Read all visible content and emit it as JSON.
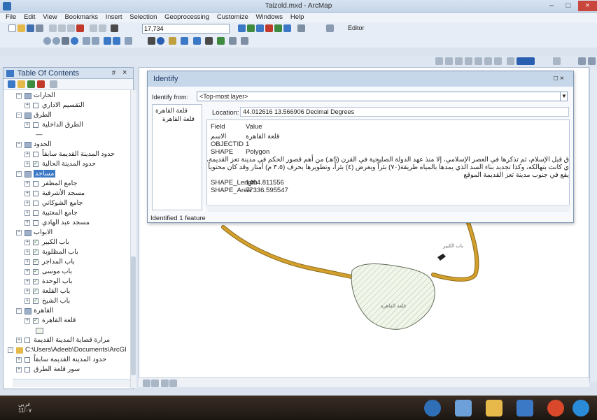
{
  "window": {
    "title": "Taizold.mxd - ArcMap"
  },
  "menu": [
    "File",
    "Edit",
    "View",
    "Bookmarks",
    "Insert",
    "Selection",
    "Geoprocessing",
    "Customize",
    "Windows",
    "Help"
  ],
  "toolbar": {
    "scale": "17,734",
    "editor_label": "Editor"
  },
  "toc": {
    "title": "Table Of Contents",
    "pin": "#",
    "close": "×",
    "rows": [
      {
        "label": "الحارات",
        "indent": 1,
        "type": "group",
        "expanded": true
      },
      {
        "label": "التقسيم الاداري",
        "indent": 2,
        "type": "layer",
        "checked": false
      },
      {
        "label": "الطرق",
        "indent": 1,
        "type": "group",
        "expanded": true
      },
      {
        "label": "الطرق الداخلية",
        "indent": 2,
        "type": "layer",
        "checked": false
      },
      {
        "label": "—",
        "indent": 3,
        "type": "legend"
      },
      {
        "label": "الحدود",
        "indent": 1,
        "type": "group",
        "expanded": true
      },
      {
        "label": "حدود المدينة القديمة سابقاً",
        "indent": 2,
        "type": "layer",
        "checked": false
      },
      {
        "label": "حدود المدينة الحالية",
        "indent": 2,
        "type": "layer",
        "checked": true
      },
      {
        "label": "مساجد",
        "indent": 1,
        "type": "group",
        "expanded": true,
        "selected": true
      },
      {
        "label": "جامع المظفر",
        "indent": 2,
        "type": "layer",
        "checked": false
      },
      {
        "label": "مسجد الأشرفية",
        "indent": 2,
        "type": "layer",
        "checked": false
      },
      {
        "label": "جامع الشوكاني",
        "indent": 2,
        "type": "layer",
        "checked": false
      },
      {
        "label": "جامع المعتبية",
        "indent": 2,
        "type": "layer",
        "checked": false
      },
      {
        "label": "مسجد عبد الهادي",
        "indent": 2,
        "type": "layer",
        "checked": false
      },
      {
        "label": "الابواب",
        "indent": 1,
        "type": "group",
        "expanded": true
      },
      {
        "label": "باب الكبير",
        "indent": 2,
        "type": "layer",
        "checked": true
      },
      {
        "label": "باب المظلوبة",
        "indent": 2,
        "type": "layer",
        "checked": true
      },
      {
        "label": "باب المداجر",
        "indent": 2,
        "type": "layer",
        "checked": true
      },
      {
        "label": "باب موسى",
        "indent": 2,
        "type": "layer",
        "checked": true
      },
      {
        "label": "باب الوحدة",
        "indent": 2,
        "type": "layer",
        "checked": true
      },
      {
        "label": "باب القلعة",
        "indent": 2,
        "type": "layer",
        "checked": true
      },
      {
        "label": "باب الشيخ",
        "indent": 2,
        "type": "layer",
        "checked": true
      },
      {
        "label": "القاهرة",
        "indent": 1,
        "type": "group",
        "expanded": true
      },
      {
        "label": "قلعة القاهرة",
        "indent": 2,
        "type": "layer",
        "checked": true
      },
      {
        "label": "",
        "indent": 3,
        "type": "swatch"
      },
      {
        "label": "مرارة قصاية المدينة القديمة",
        "indent": 1,
        "type": "layer",
        "checked": false
      },
      {
        "label": "C:\\Users\\Adeeb\\Documents\\ArcGI",
        "indent": 0,
        "type": "folder",
        "expanded": true
      },
      {
        "label": "حدود المدينة القديمة سابقاً",
        "indent": 1,
        "type": "layer",
        "checked": false
      },
      {
        "label": "سور قلعة الطرق",
        "indent": 1,
        "type": "layer",
        "checked": false
      }
    ]
  },
  "identify": {
    "title": "Identify",
    "win_buttons": "□ ×",
    "from_label": "Identify from:",
    "from_value": "<Top-most layer>",
    "tree_parent": "قلعة القاهرة",
    "tree_child": "قلعة القاهرة",
    "location_label": "Location:",
    "location_value": "44.012616  13.566906 Decimal Degrees",
    "grid_header": {
      "field": "Field",
      "value": "Value"
    },
    "rows": [
      {
        "field": "الاسم",
        "value": "قلعة القاهرة"
      },
      {
        "field": "OBJECTID",
        "value": "1"
      },
      {
        "field": "SHAPE",
        "value": "Polygon"
      },
      {
        "field": "",
        "value": "ق قبل الإسلام، ثم تذكرها في العصر الإسلامي، إلا منذ عهد الدولة الصليحية في القرن (5هـ) من أهم قصور الحكم في مدينة تعز القديمة، وهي أهم قوى الضيافة  الوصف التاريخي"
      },
      {
        "field": "",
        "value": "ي كانت بتهالكه، وكذا تجديد بناء السد الذي يمدها بالمياه طريقة(٧٠) بئراً وبعرض (٤) بئراً، وتطويرها بحرف (٣،٥ م) أمتار وقد كان محتوياً تحت الإغلاق، كما أصيب   أعمال الترميم"
      },
      {
        "field": "",
        "value": "يقع في جنوب مدينة تعز القديمة    الموقع"
      },
      {
        "field": "SHAPE_Length",
        "value": "1404.811556"
      },
      {
        "field": "SHAPE_Area",
        "value": "77336.595547"
      }
    ],
    "footer": "Identified 1 feature"
  },
  "map": {
    "label_small": "باب الكبير",
    "label_polygon": "قلعة القاهرة",
    "road_color": "#d4a02c",
    "polygon_fill": "#eef4e6"
  },
  "status": {
    "coords": ""
  },
  "taskbar": {
    "lang": "عربي",
    "date": "11/٠٧"
  }
}
